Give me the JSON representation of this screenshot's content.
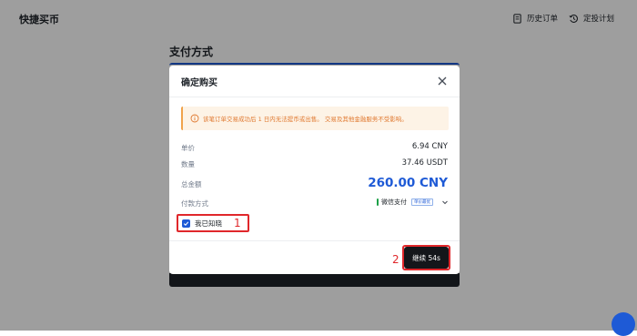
{
  "app": {
    "title": "快捷买币"
  },
  "nav": {
    "history": {
      "label": "历史订单",
      "icon": "document-icon"
    },
    "recurring": {
      "label": "定投计划",
      "icon": "clock-history-icon"
    }
  },
  "page": {
    "section_title": "支付方式"
  },
  "modal": {
    "title": "确定购买",
    "notice": "该笔订单交易成功后 1 日内无法提币或出售。 交易及其他金融服务不受影响。",
    "rows": {
      "unit_price": {
        "label": "单价",
        "value": "6.94 CNY"
      },
      "quantity": {
        "label": "数量",
        "value": "37.46 USDT"
      },
      "total": {
        "label": "总金额",
        "value": "260.00 CNY"
      },
      "payment": {
        "label": "付款方式",
        "method": "微信支付",
        "tag": "单价最优"
      }
    },
    "acknowledge": {
      "label": "我已知晓",
      "checked": true
    },
    "continue_button": "继续 54s"
  },
  "annotations": {
    "one": "1",
    "two": "2"
  },
  "colors": {
    "accent": "#1e5ad6",
    "warning_text": "#e0782f",
    "warning_bg": "#fdf3e6",
    "highlight_red": "#e0272b",
    "button_dark": "#14161a",
    "wechat_green": "#1ca047"
  }
}
